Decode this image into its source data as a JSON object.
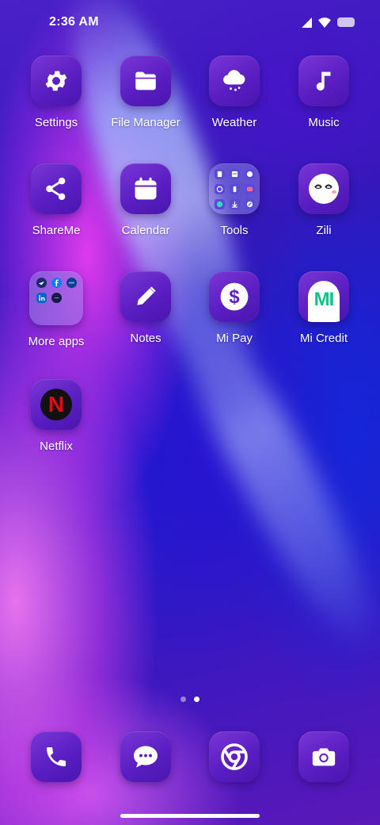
{
  "status_bar": {
    "time": "2:36 AM"
  },
  "apps": [
    {
      "label": "Settings",
      "icon": "gear-icon"
    },
    {
      "label": "File Manager",
      "icon": "folder-icon"
    },
    {
      "label": "Weather",
      "icon": "cloud-rain-icon"
    },
    {
      "label": "Music",
      "icon": "music-note-icon"
    },
    {
      "label": "ShareMe",
      "icon": "share-icon"
    },
    {
      "label": "Calendar",
      "icon": "calendar-icon"
    },
    {
      "label": "Tools",
      "icon": "tools-folder-icon"
    },
    {
      "label": "Zili",
      "icon": "zili-face-icon"
    },
    {
      "label": "More apps",
      "icon": "more-apps-folder-icon"
    },
    {
      "label": "Notes",
      "icon": "pencil-icon"
    },
    {
      "label": "Mi Pay",
      "icon": "dollar-icon"
    },
    {
      "label": "Mi Credit",
      "icon": "mi-credit-logo-icon"
    },
    {
      "label": "Netflix",
      "icon": "netflix-logo-icon"
    }
  ],
  "mi_credit_logo_text": "MI",
  "netflix_logo_text": "N",
  "dock": [
    {
      "label": "Phone",
      "icon": "phone-icon"
    },
    {
      "label": "Messages",
      "icon": "chat-bubble-icon"
    },
    {
      "label": "Chrome",
      "icon": "chrome-icon"
    },
    {
      "label": "Camera",
      "icon": "camera-icon"
    }
  ],
  "pager": {
    "pages": 2,
    "active_page": 2
  },
  "colors": {
    "icon_bg": "#5a1ec2",
    "netflix_red": "#e50914",
    "mi_credit_green": "#12c28a"
  }
}
